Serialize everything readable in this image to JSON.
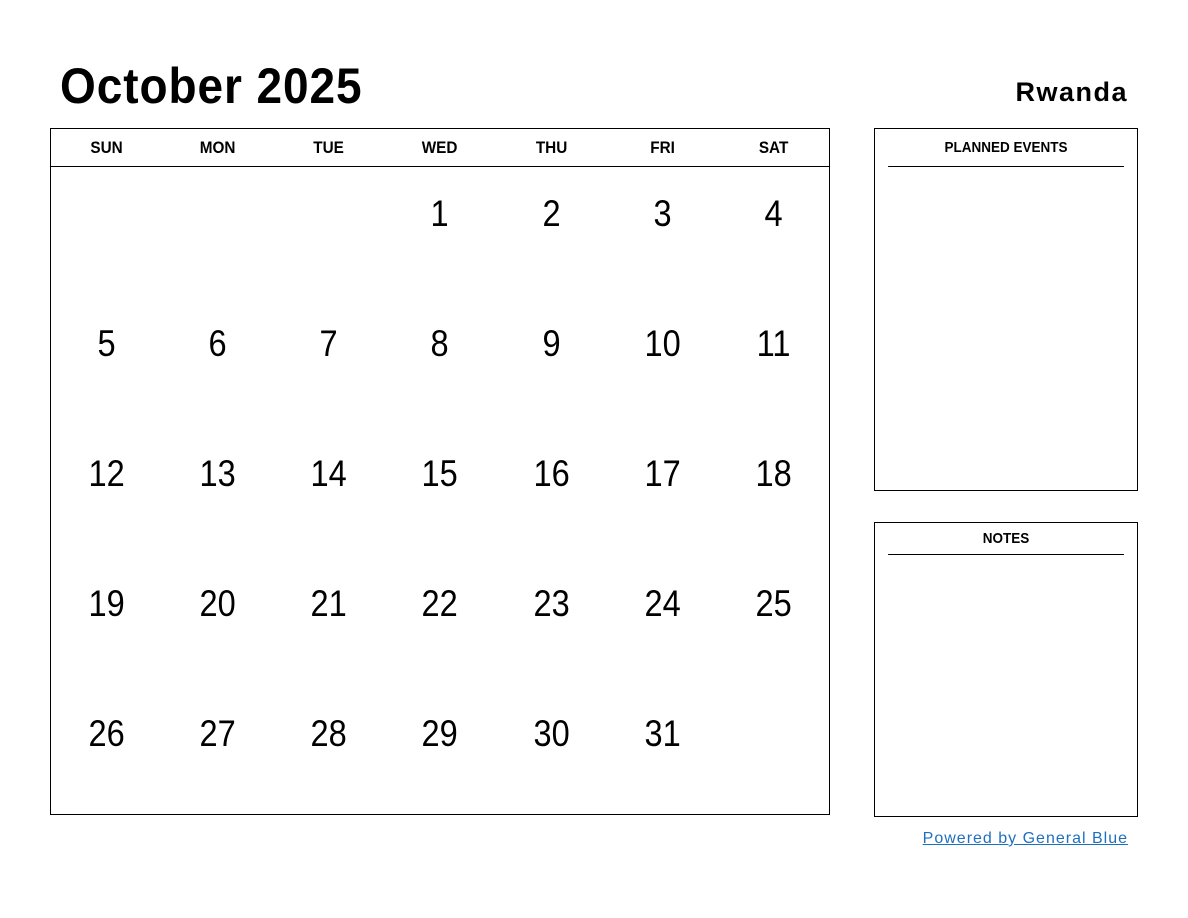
{
  "header": {
    "title": "October 2025",
    "country": "Rwanda"
  },
  "calendar": {
    "weekdays": [
      "SUN",
      "MON",
      "TUE",
      "WED",
      "THU",
      "FRI",
      "SAT"
    ],
    "weeks": [
      [
        "",
        "",
        "",
        "1",
        "2",
        "3",
        "4"
      ],
      [
        "5",
        "6",
        "7",
        "8",
        "9",
        "10",
        "11"
      ],
      [
        "12",
        "13",
        "14",
        "15",
        "16",
        "17",
        "18"
      ],
      [
        "19",
        "20",
        "21",
        "22",
        "23",
        "24",
        "25"
      ],
      [
        "26",
        "27",
        "28",
        "29",
        "30",
        "31",
        ""
      ]
    ]
  },
  "panels": {
    "events_label": "PLANNED EVENTS",
    "notes_label": "NOTES"
  },
  "footer": {
    "link_text": "Powered by General Blue",
    "link_color": "#1f6fbf"
  }
}
